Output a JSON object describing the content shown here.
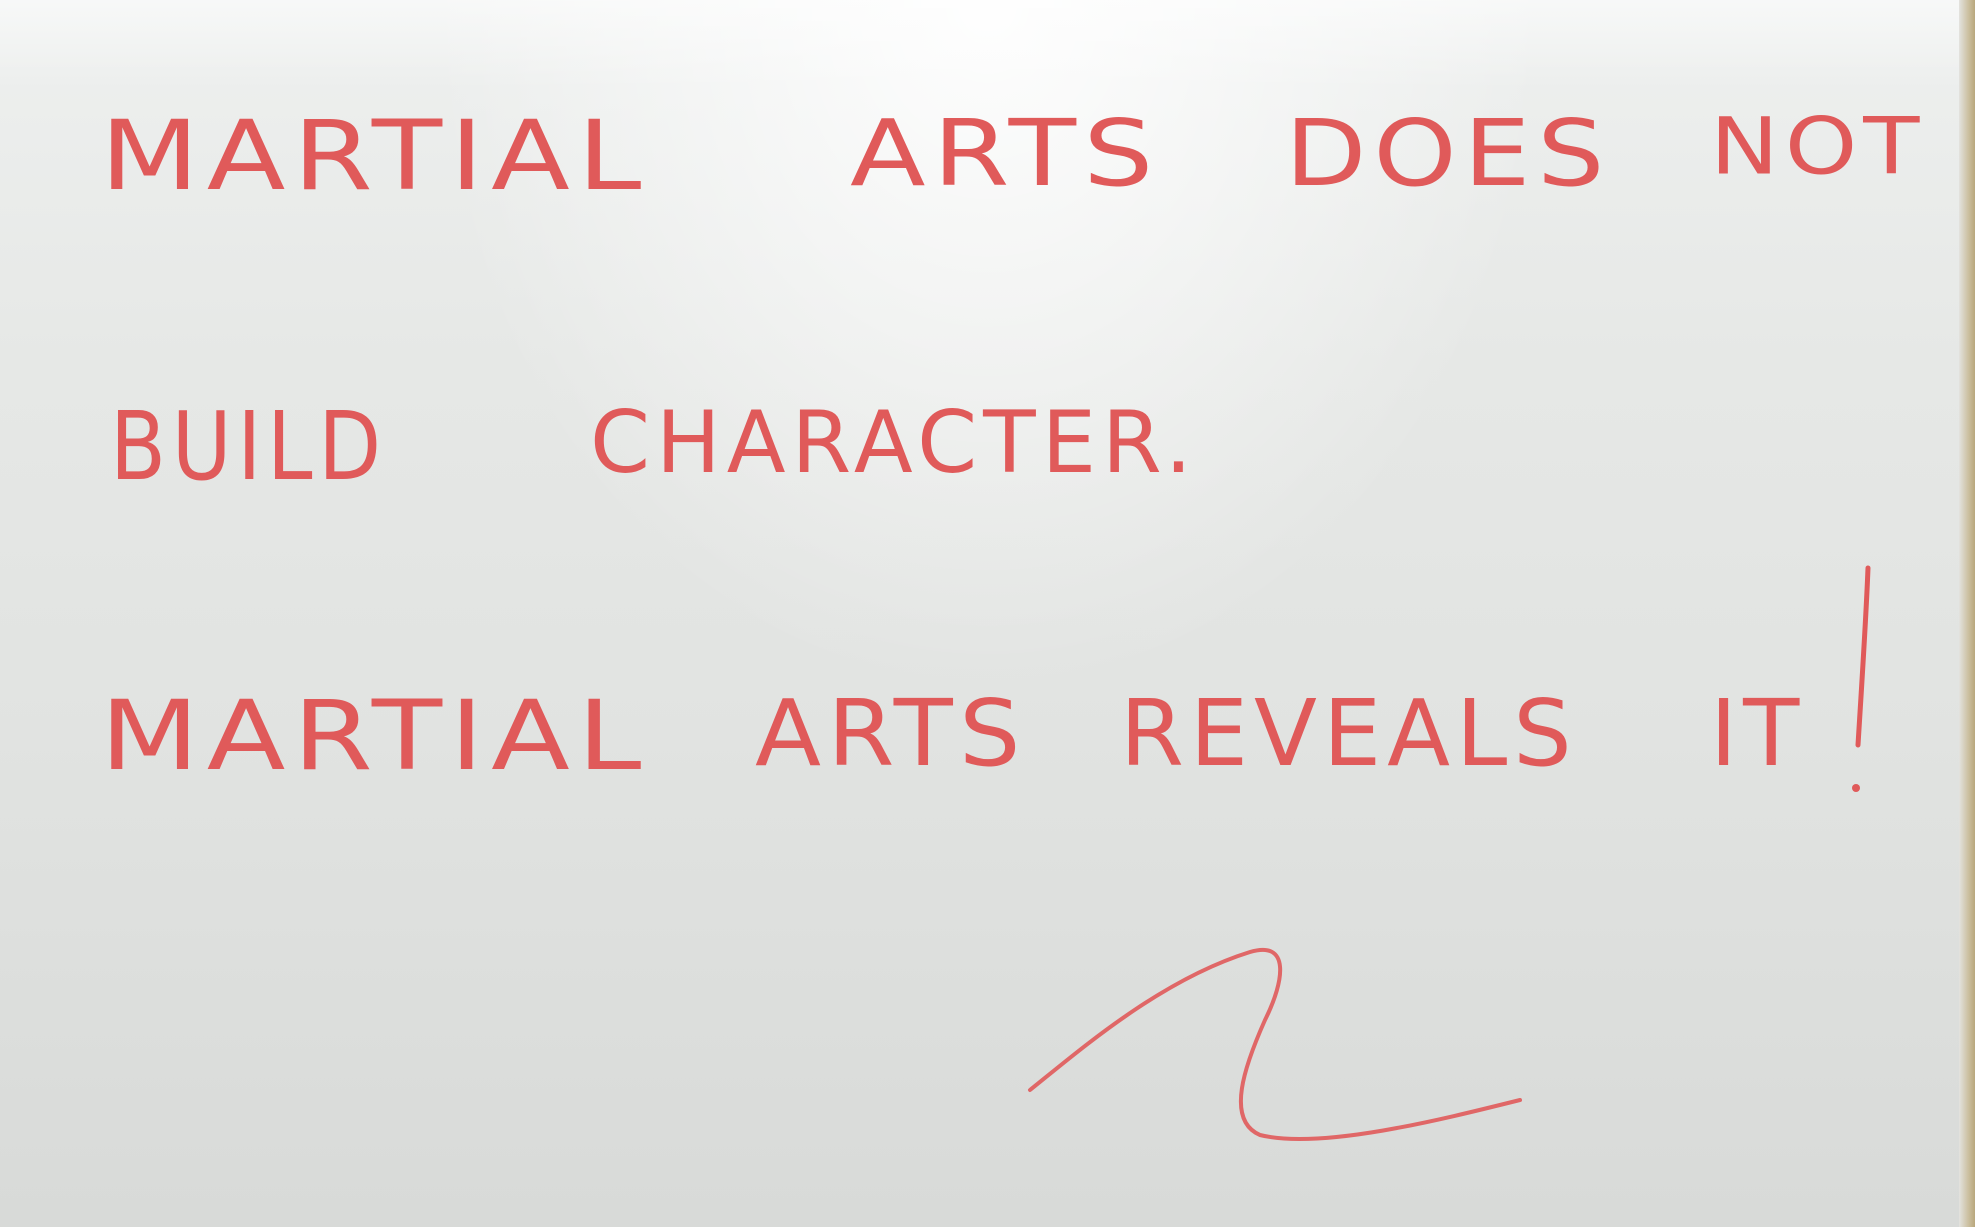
{
  "board": {
    "background_color": "#e4e6e4",
    "ink_color": "#e05a5a",
    "lines": [
      {
        "words": [
          "MARTIAL",
          "ARTS",
          "DOES",
          "NOT"
        ]
      },
      {
        "words": [
          "BUILD",
          "CHARACTER."
        ]
      },
      {
        "words": [
          "MARTIAL",
          "ARTS",
          "REVEALS",
          "IT"
        ]
      }
    ],
    "exclamation": "!"
  }
}
